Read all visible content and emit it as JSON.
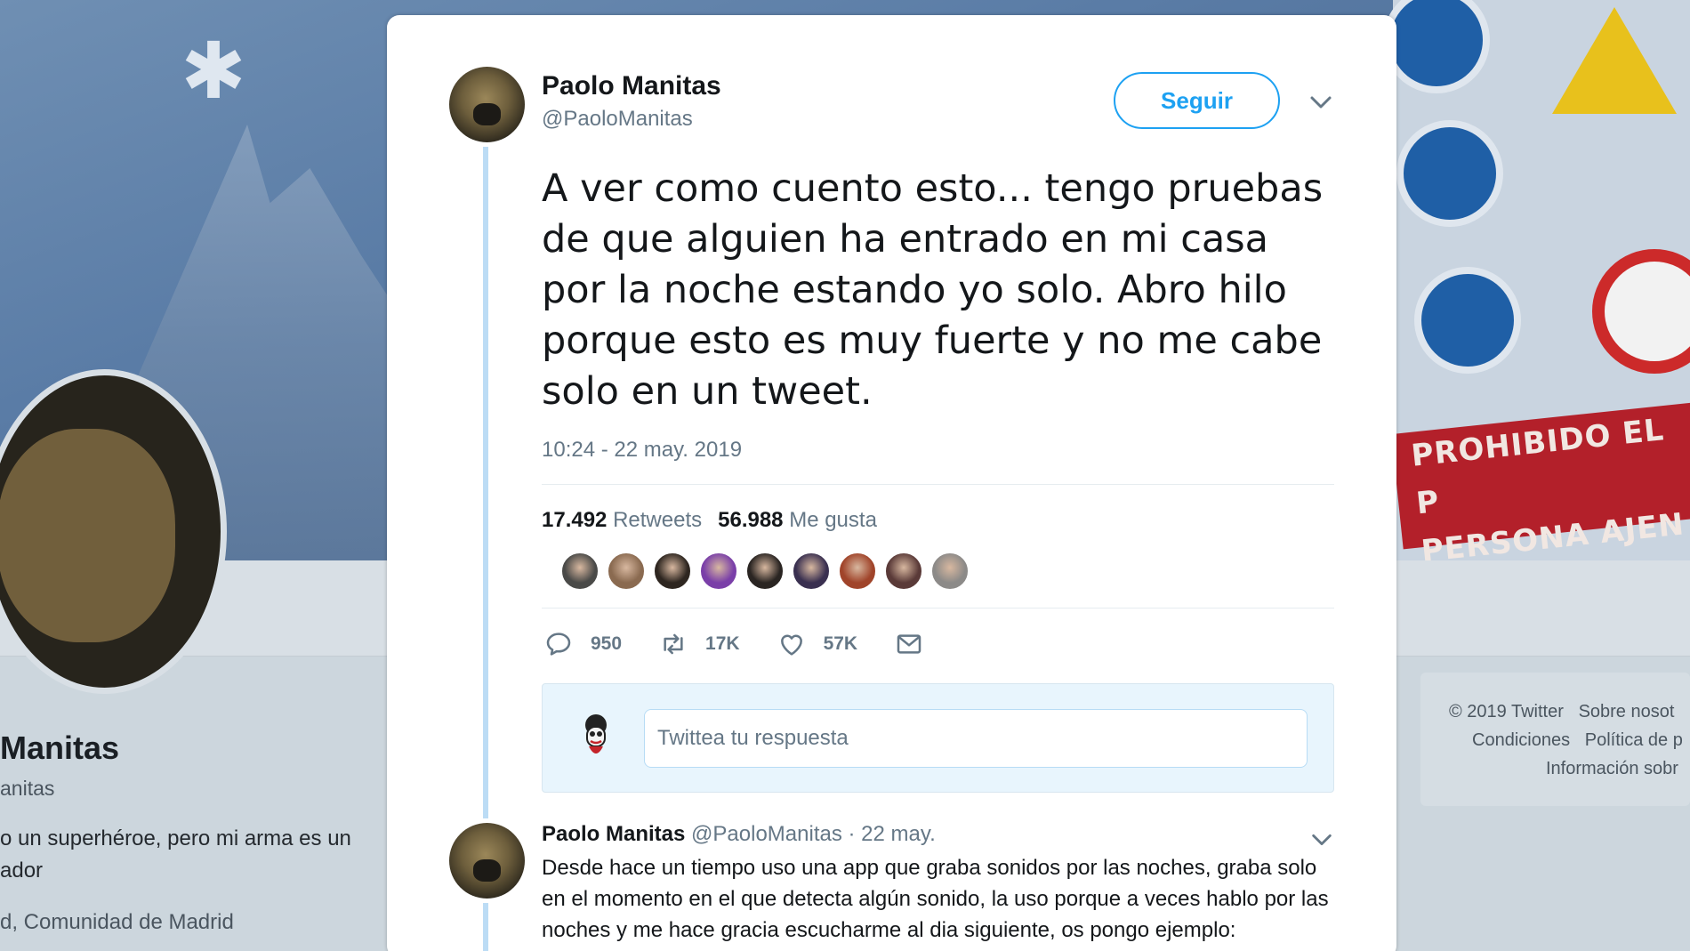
{
  "background_profile": {
    "name": "Manitas",
    "handle": "anitas",
    "bio": "o un superhéroe, pero mi arma es un ador",
    "bio_lines": [
      "o un superhéroe, pero mi arma es un",
      "ador"
    ],
    "location": "d, Comunidad de Madrid",
    "banner_sign_lines": [
      "PROHIBIDO EL P",
      "PERSONA AJEN"
    ],
    "footer": {
      "copyright": "© 2019 Twitter",
      "about": "Sobre nosot",
      "terms": "Condiciones",
      "privacy": "Política de p",
      "info": "Información sobr"
    }
  },
  "tweet": {
    "author_name": "Paolo Manitas",
    "author_handle": "@PaoloManitas",
    "follow_label": "Seguir",
    "text": "A ver como cuento esto... tengo pruebas de que alguien ha entrado en mi casa por la noche estando yo solo. Abro hilo porque esto es muy fuerte y no me cabe solo en un tweet.",
    "timestamp": "10:24 - 22 may. 2019",
    "retweets_count": "17.492",
    "retweets_label": "Retweets",
    "likes_count": "56.988",
    "likes_label": "Me gusta",
    "actions": {
      "reply_count": "950",
      "retweet_count": "17K",
      "like_count": "57K"
    },
    "liker_avatar_colors": [
      "#4a4a48",
      "#8a6a50",
      "#2e2620",
      "#7a3fa8",
      "#2a2522",
      "#3a3050",
      "#a0442a",
      "#5a3a38",
      "#8c8a88"
    ]
  },
  "reply_composer": {
    "placeholder": "Twittea tu respuesta"
  },
  "reply_tweet": {
    "author_name": "Paolo Manitas",
    "author_handle": "@PaoloManitas",
    "date": "· 22 may.",
    "text": "Desde hace un tiempo uso una app que graba sonidos por las noches, graba solo en el momento en el que detecta algún sonido, la uso porque a veces hablo por las noches y me hace gracia escucharme al dia siguiente, os pongo ejemplo:"
  },
  "colors": {
    "accent": "#1da1f2",
    "secondary_text": "#657786",
    "thread_line": "#bcdcf5"
  }
}
